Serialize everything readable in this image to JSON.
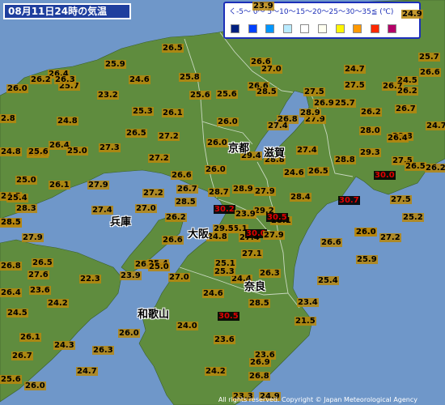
{
  "title": "08月11日24時の気温",
  "legend": {
    "label": "く-5～ 0～ 5～10～15～20～25～30～35≦ (℃)",
    "colors": [
      "#002080",
      "#0041ff",
      "#0096ff",
      "#b9ebff",
      "#ffffff",
      "#fffff0",
      "#fff500",
      "#ff9900",
      "#ff2800",
      "#b40068"
    ]
  },
  "colors": {
    "sea": "#6f97c9",
    "land": "#5f8c3e",
    "hot_text": "#e00000",
    "label_bg": "#b8860b"
  },
  "places": [
    "京都",
    "滋賀",
    "兵庫",
    "大阪",
    "奈良",
    "和歌山"
  ],
  "temperatures": [
    "23.9",
    "24.9",
    "26.5",
    "25.9",
    "26.6",
    "25.7",
    "24.7",
    "27.0",
    "26.4",
    "26.2",
    "26.6",
    "24.5",
    "24.6",
    "25.7",
    "26.3",
    "25.8",
    "26.7",
    "27.5",
    "26.0",
    "23.2",
    "25.6",
    "26.6",
    "27.5",
    "26.2",
    "25.6",
    "26.9",
    "25.7",
    "28.5",
    "26.7",
    "25.3",
    "26.1",
    "26.8",
    "2.8",
    "24.8",
    "27.9",
    "26.2",
    "24.7",
    "28.0",
    "26.0",
    "27.4",
    "28.9",
    "27.2",
    "26.5",
    "25.6",
    "29.8",
    "24.8",
    "25.6",
    "26.4",
    "25.0",
    "27.3",
    "27.2",
    "29.3",
    "26.4",
    "28.8",
    "27.5",
    "26.0",
    "27.4",
    "28.8",
    "26.5",
    "29.4",
    "24.6",
    "26.5",
    "30.0",
    "26.2",
    "25.0",
    "27.9",
    "26.6",
    "28.4",
    "24.5",
    "26.0",
    "28.9",
    "27.9",
    "25.4",
    "26.1",
    "27.0",
    "30.7",
    "27.5",
    "28.3",
    "28.7",
    "26.7",
    "27.2",
    "27.4",
    "28.5",
    "29.2",
    "26.2",
    "30.2",
    "23.9",
    "26.5",
    "28.1",
    "25.1",
    "30.5",
    "25.2",
    "27.9",
    "29.5",
    "27.9",
    "27.2",
    "28.5",
    "27.4",
    "30.0",
    "26.0",
    "24.8",
    "27.9",
    "26.6",
    "26.5",
    "26.6",
    "27.1",
    "26.2",
    "25.9",
    "25.4",
    "25.0",
    "26.8",
    "25.1",
    "27.6",
    "22.3",
    "23.9",
    "27.0",
    "24.4",
    "26.3",
    "25.4",
    "26.4",
    "25.3",
    "23.6",
    "24.5",
    "24.2",
    "24.6",
    "28.5",
    "23.4",
    "30.5",
    "21.5",
    "26.1",
    "26.0",
    "24.0",
    "24.3",
    "23.6",
    "26.7",
    "23.6",
    "24.7",
    "26.3",
    "25.6",
    "26.8",
    "26.0",
    "24.2",
    "23.3",
    "26.9",
    "24.9"
  ]
}
